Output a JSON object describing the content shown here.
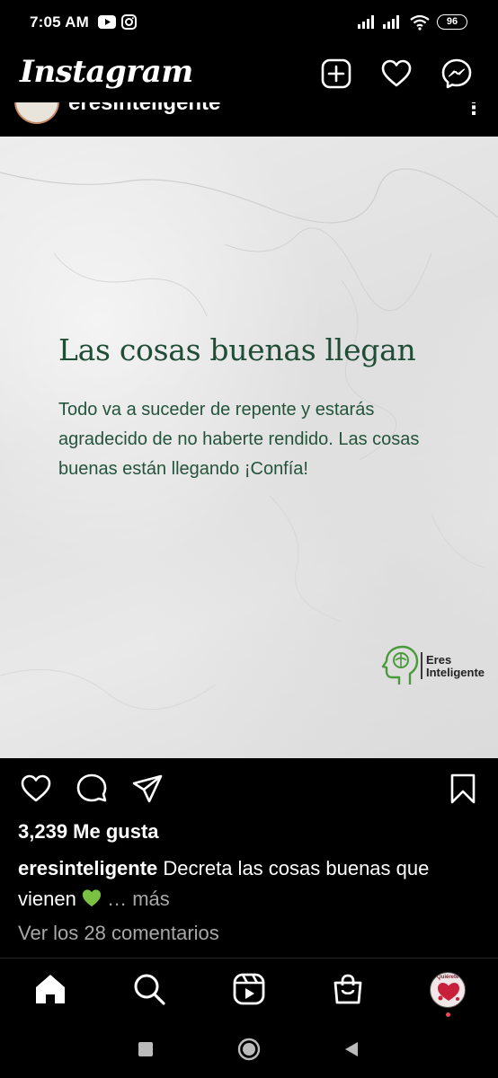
{
  "status": {
    "time": "7:05 AM",
    "battery": "96"
  },
  "app": {
    "logo": "Instagram"
  },
  "icons": {
    "youtube": "youtube-icon",
    "instagram": "instagram-icon",
    "new_post": "plus-square-icon",
    "activity": "heart-icon",
    "messenger": "messenger-icon",
    "like": "heart-icon",
    "comment": "comment-icon",
    "share": "send-icon",
    "save": "bookmark-icon",
    "home": "home-icon",
    "search": "search-icon",
    "reels": "reels-icon",
    "shop": "shopping-bag-icon"
  },
  "post": {
    "username": "eresinteligente",
    "image_title": "Las cosas buenas llegan",
    "image_body": "Todo va a suceder de repente y estarás agradecido de no haberte rendido. Las cosas buenas están llegando ¡Confía!",
    "brand_line1": "Eres",
    "brand_line2": "Inteligente",
    "likes": "3,239 Me gusta",
    "caption_user": "eresinteligente",
    "caption_text": "Decreta las cosas buenas que vienen",
    "caption_more": "… más",
    "comments_link": "Ver los 28 comentarios"
  },
  "profile": {
    "avatar_text": "Quiérete"
  },
  "colors": {
    "accent_green": "#1f4d36",
    "notification": "#ed4956",
    "background": "#000000"
  }
}
